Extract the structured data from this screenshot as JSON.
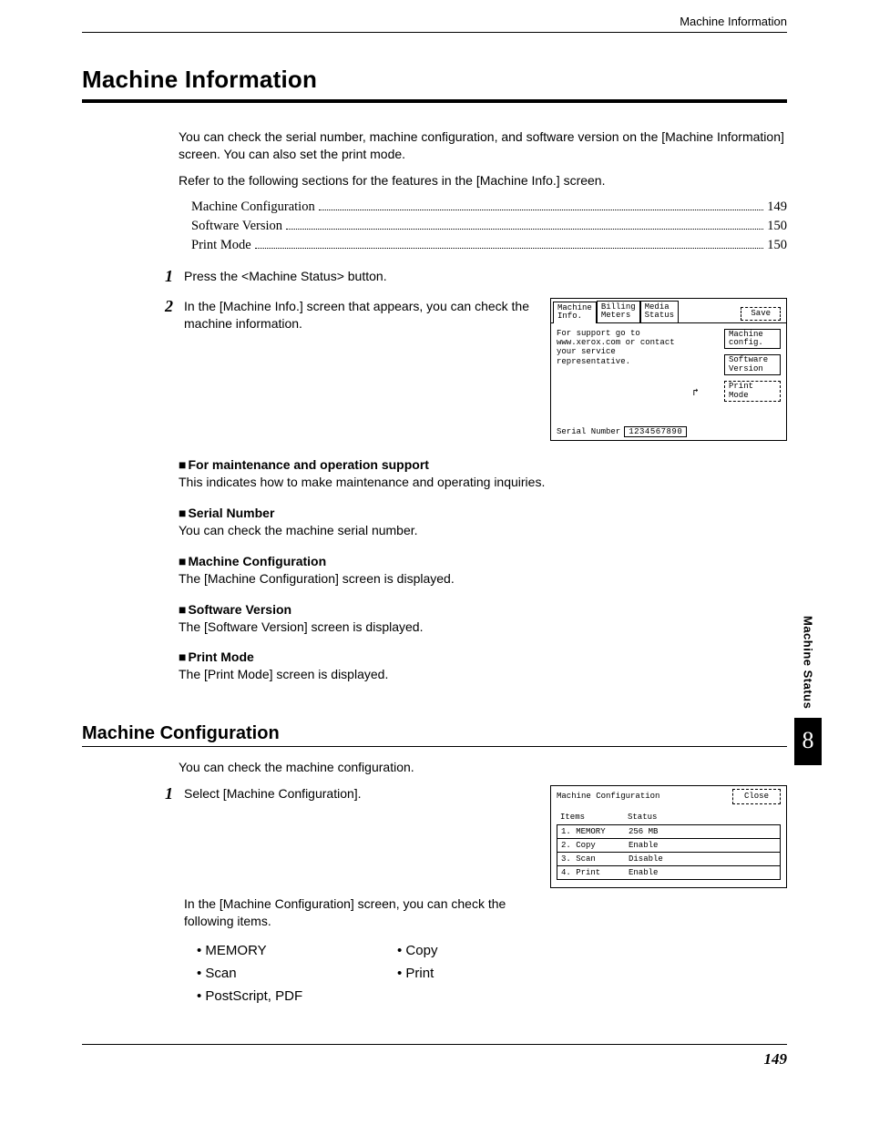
{
  "running_head": "Machine Information",
  "title": "Machine Information",
  "intro": {
    "p1": "You can check the serial number, machine configuration, and software version on the [Machine Information] screen. You can also set the print mode.",
    "p2": "Refer to the following sections for the features in the [Machine Info.] screen."
  },
  "toc": [
    {
      "label": "Machine Configuration",
      "page": "149"
    },
    {
      "label": "Software Version",
      "page": "150"
    },
    {
      "label": "Print Mode",
      "page": "150"
    }
  ],
  "steps1": {
    "s1": "Press the <Machine Status> button.",
    "s2": "In the [Machine Info.] screen that appears, you can check the machine information."
  },
  "screen1": {
    "tab1a": "Machine",
    "tab1b": "Info.",
    "tab2a": "Billing",
    "tab2b": "Meters",
    "tab3a": "Media",
    "tab3b": "Status",
    "save": "Save",
    "support1": "For support go to",
    "support2": "www.xerox.com or contact",
    "support3": "your service representative.",
    "btn1a": "Machine",
    "btn1b": "config.",
    "btn2a": "Software",
    "btn2b": "Version",
    "btn3": "Print Mode",
    "serial_label": "Serial Number",
    "serial_value": "1234567890"
  },
  "defs": [
    {
      "head": "For maintenance and operation support",
      "body": "This indicates how to make maintenance and operating inquiries."
    },
    {
      "head": "Serial Number",
      "body": "You can check the machine serial number."
    },
    {
      "head": "Machine Configuration",
      "body": "The [Machine Configuration] screen is displayed."
    },
    {
      "head": "Software Version",
      "body": "The [Software Version] screen is displayed."
    },
    {
      "head": "Print Mode",
      "body": "The [Print Mode] screen is displayed."
    }
  ],
  "subtitle": "Machine Configuration",
  "sub_intro": "You can check the machine configuration.",
  "steps2": {
    "s1": "Select [Machine Configuration]."
  },
  "screen2": {
    "title": "Machine Configuration",
    "close": "Close",
    "col_items": "Items",
    "col_status": "Status",
    "rows": [
      {
        "item": "1. MEMORY",
        "status": "256 MB"
      },
      {
        "item": "2. Copy",
        "status": "Enable"
      },
      {
        "item": "3. Scan",
        "status": "Disable"
      },
      {
        "item": "4. Print",
        "status": "Enable"
      }
    ]
  },
  "after_cfg": "In the [Machine Configuration] screen, you can check the following items.",
  "bullets": [
    "MEMORY",
    "Copy",
    "Scan",
    "Print",
    "PostScript, PDF"
  ],
  "side": {
    "label": "Machine Status",
    "chapter": "8"
  },
  "page_number": "149"
}
